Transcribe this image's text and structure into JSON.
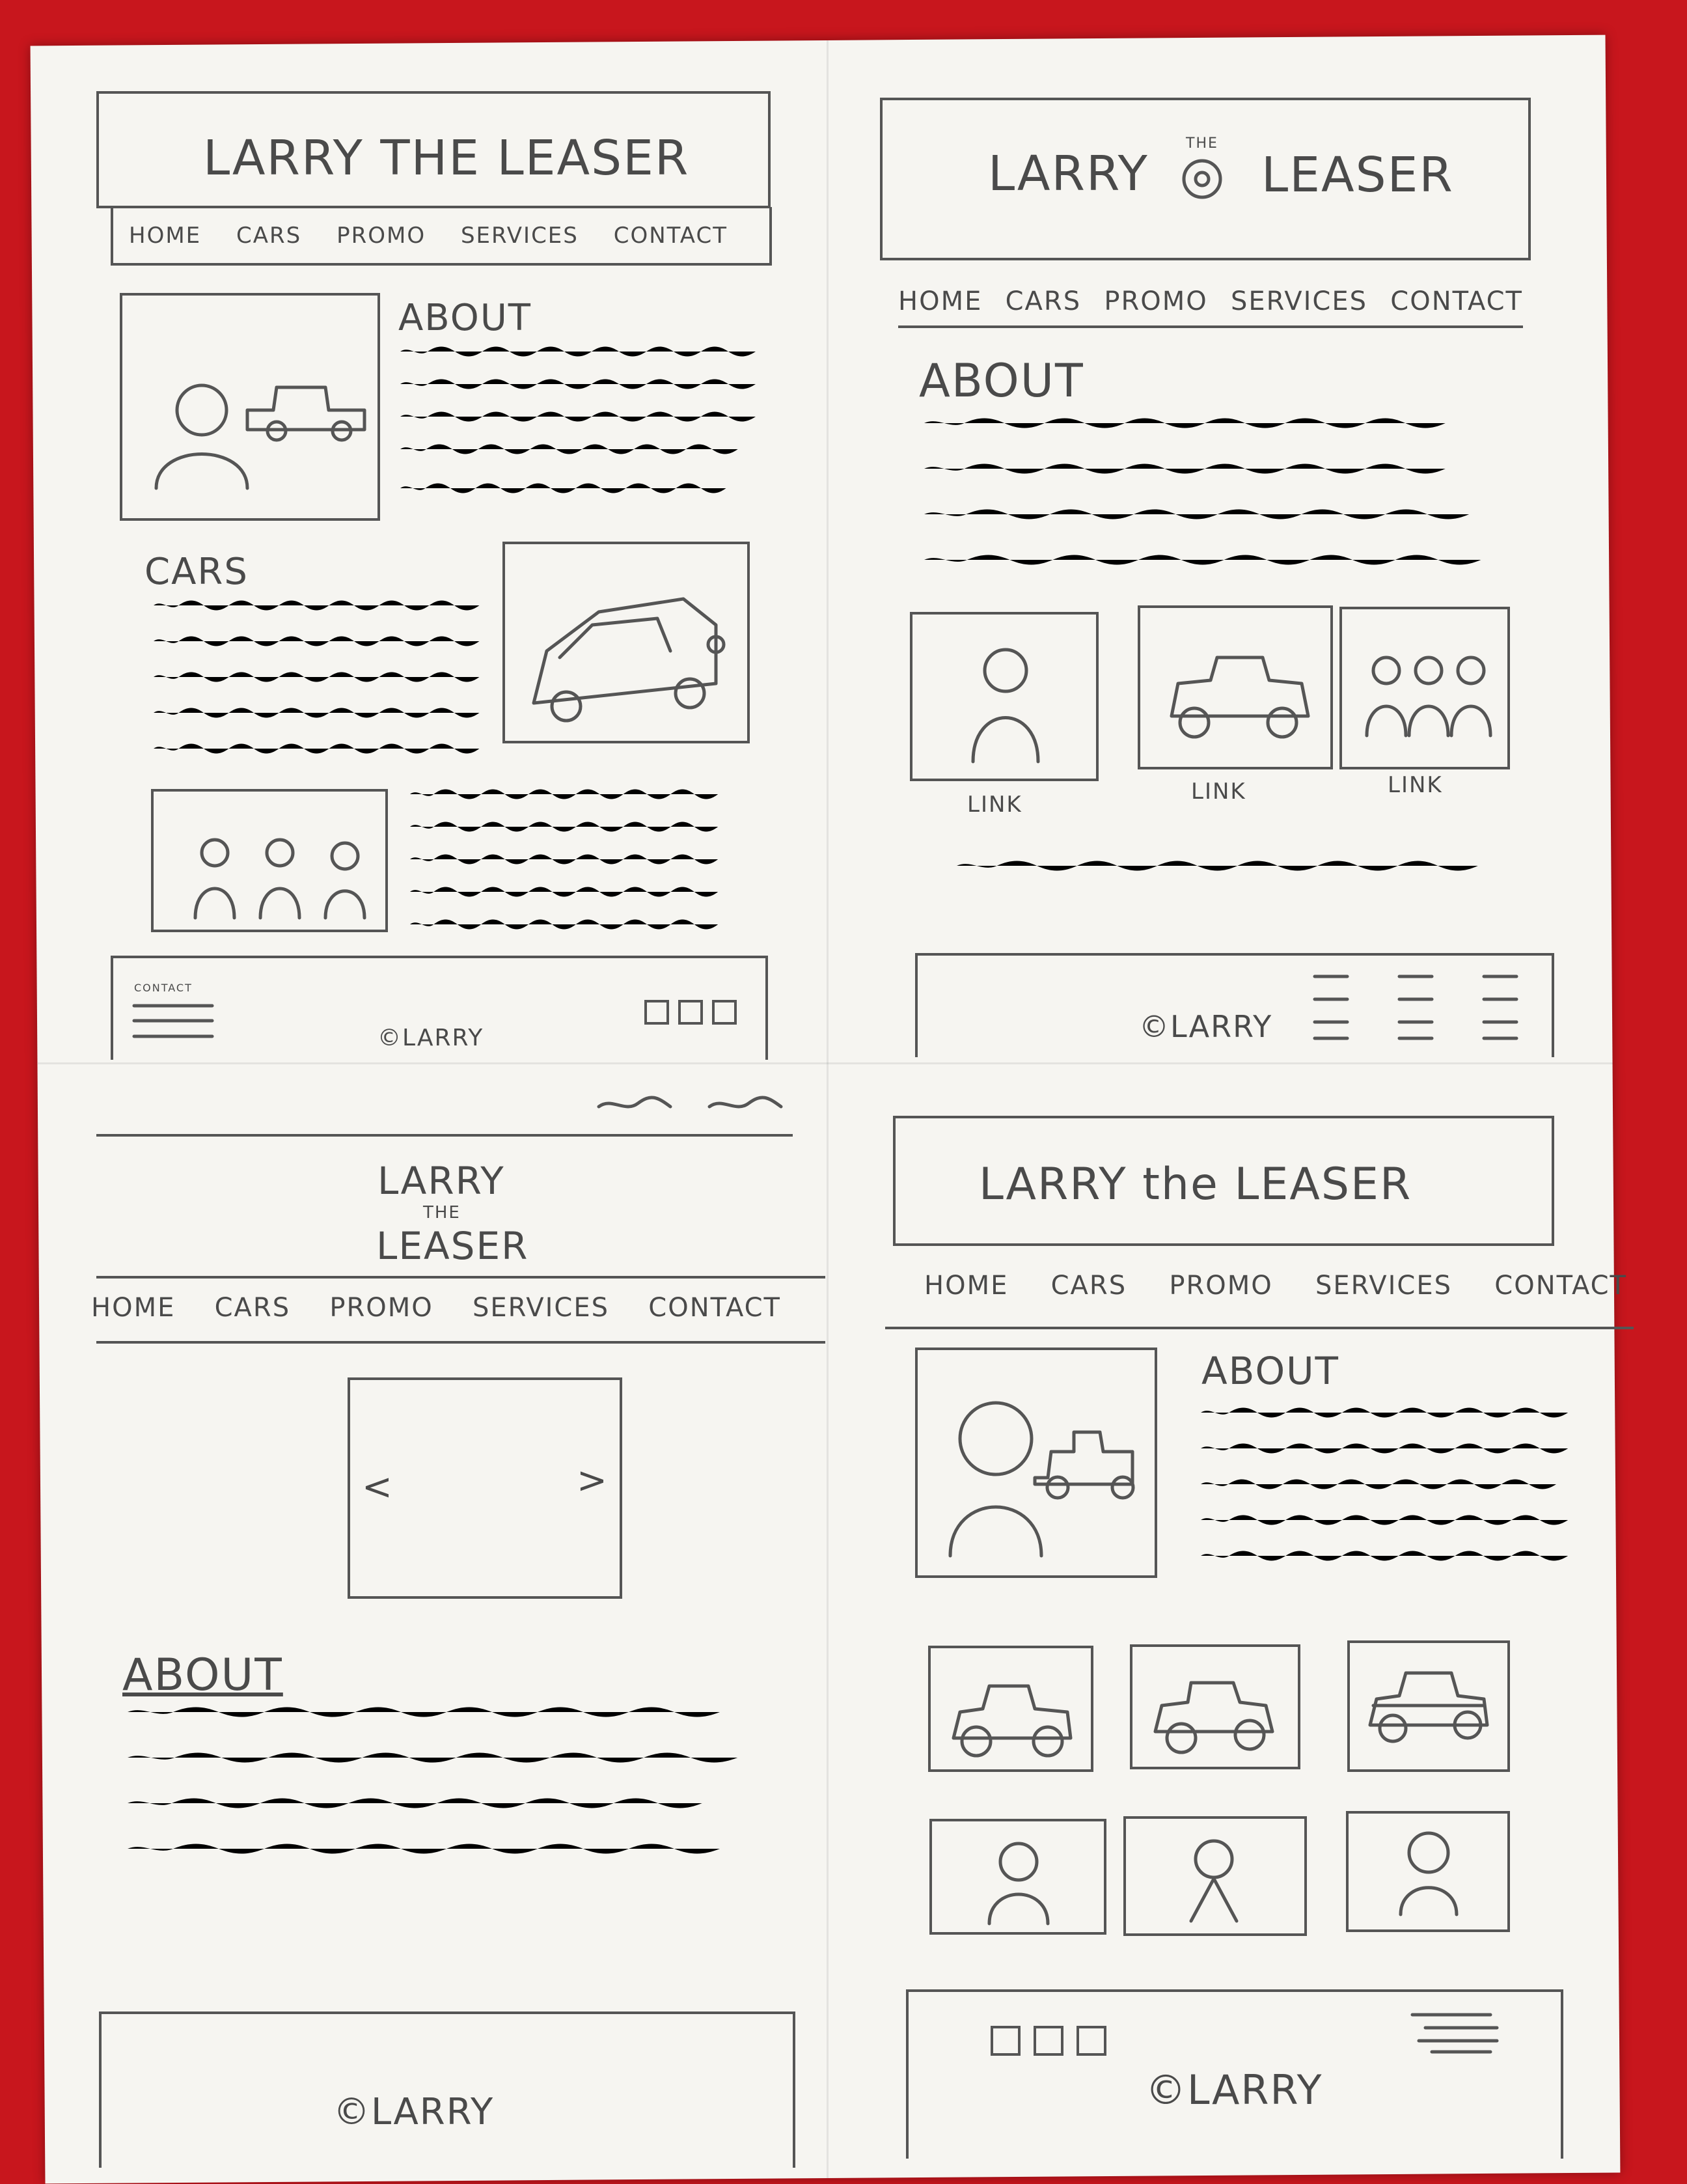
{
  "sketches": {
    "top_left": {
      "title": "LARRY THE LEASER",
      "nav": [
        "HOME",
        "CARS",
        "PROMO",
        "SERVICES",
        "CONTACT"
      ],
      "about_heading": "ABOUT",
      "cars_heading": "CARS",
      "footer_contact": "CONTACT",
      "footer_copyright": "©LARRY"
    },
    "top_right": {
      "title_left": "LARRY",
      "title_small": "THE",
      "title_right": "LEASER",
      "nav": [
        "HOME",
        "CARS",
        "PROMO",
        "SERVICES",
        "CONTACT"
      ],
      "about_heading": "ABOUT",
      "links": [
        "LINK",
        "LINK",
        "LINK"
      ],
      "footer_copyright": "©LARRY"
    },
    "bottom_left": {
      "title_line1": "LARRY",
      "title_line2": "THE",
      "title_line3": "LEASER",
      "nav": [
        "HOME",
        "CARS",
        "PROMO",
        "SERVICES",
        "CONTACT"
      ],
      "carousel_prev": "<",
      "carousel_next": ">",
      "about_heading": "ABOUT",
      "footer_copyright": "©LARRY"
    },
    "bottom_right": {
      "title": "LARRY the LEASER",
      "nav": [
        "HOME",
        "CARS",
        "PROMO",
        "SERVICES",
        "CONTACT"
      ],
      "about_heading": "ABOUT",
      "footer_copyright": "©LARRY"
    }
  },
  "icons": {
    "social": [
      "facebook-icon",
      "instagram-icon",
      "linkedin-icon"
    ],
    "menu": "menu-lines-icon"
  },
  "colors": {
    "background": "#c8161d",
    "paper": "#f6f5f1",
    "pencil": "#555555"
  }
}
